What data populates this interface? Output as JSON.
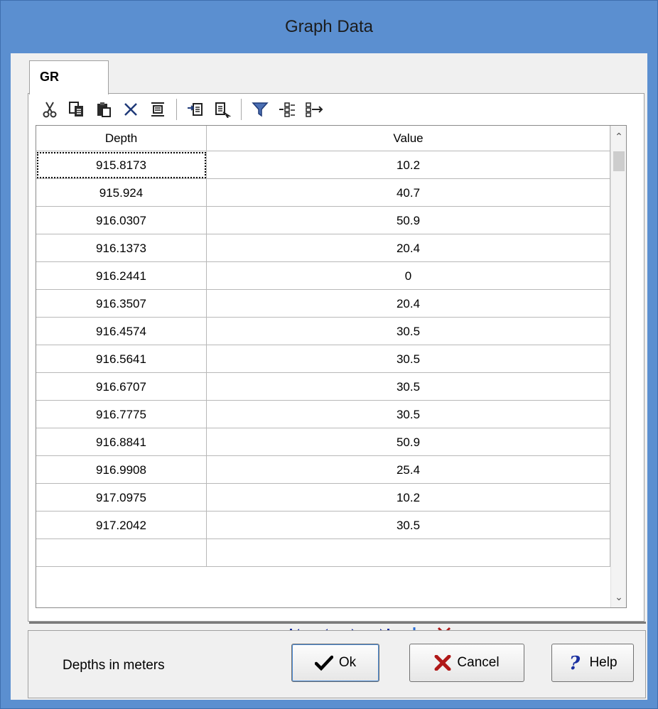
{
  "window": {
    "title": "Graph Data"
  },
  "tabs": [
    {
      "label": "GR",
      "active": true
    }
  ],
  "toolbar": {
    "groups": [
      [
        "cut-icon",
        "copy-icon",
        "paste-icon",
        "delete-icon",
        "select-all-icon"
      ],
      [
        "import-icon",
        "export-icon"
      ],
      [
        "filter-icon",
        "expand-icon",
        "collapse-icon"
      ]
    ]
  },
  "grid": {
    "columns": [
      "Depth",
      "Value"
    ],
    "rows": [
      [
        "915.8173",
        "10.2"
      ],
      [
        "915.924",
        "40.7"
      ],
      [
        "916.0307",
        "50.9"
      ],
      [
        "916.1373",
        "20.4"
      ],
      [
        "916.2441",
        "0"
      ],
      [
        "916.3507",
        "20.4"
      ],
      [
        "916.4574",
        "30.5"
      ],
      [
        "916.5641",
        "30.5"
      ],
      [
        "916.6707",
        "30.5"
      ],
      [
        "916.7775",
        "30.5"
      ],
      [
        "916.8841",
        "50.9"
      ],
      [
        "916.9908",
        "25.4"
      ],
      [
        "917.0975",
        "10.2"
      ],
      [
        "917.2042",
        "30.5"
      ]
    ]
  },
  "navigator": [
    "first-record-icon",
    "prior-record-icon",
    "next-record-icon",
    "last-record-icon",
    "add-record-icon",
    "delete-record-icon"
  ],
  "footer": {
    "note": "Depths in meters",
    "ok_label": "Ok",
    "cancel_label": "Cancel",
    "help_label": "Help"
  },
  "colors": {
    "window_frame": "#5b8fd0",
    "nav_blue": "#1a2fa0",
    "delete_red": "#b01818"
  }
}
